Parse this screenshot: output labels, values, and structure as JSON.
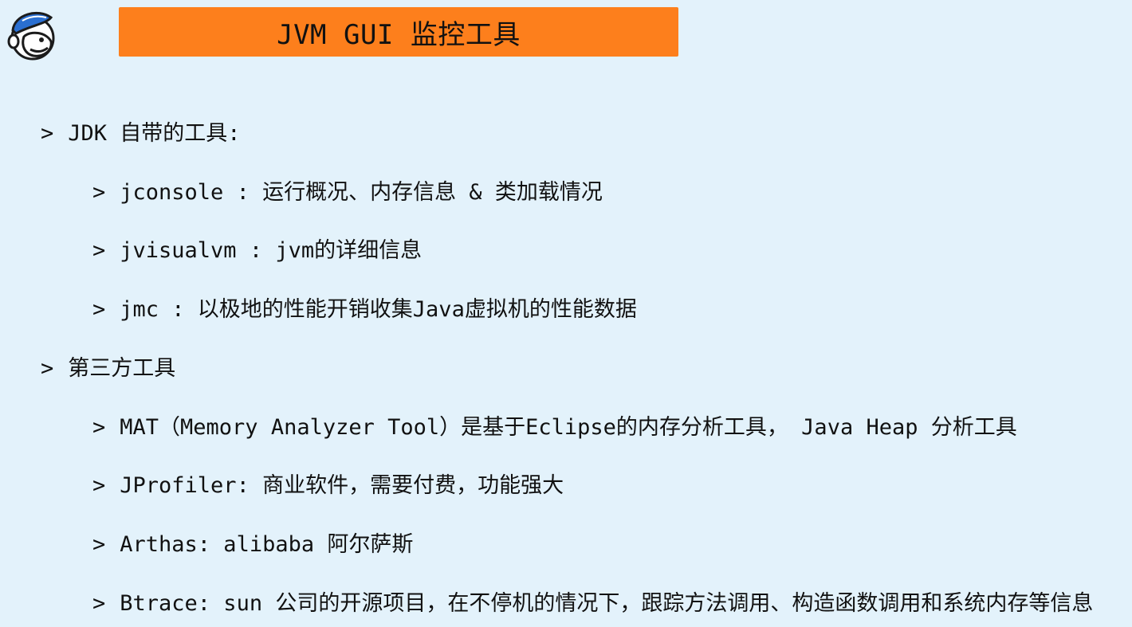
{
  "title": "JVM GUI 监控工具",
  "logo": {
    "icon": "chimp-mascot-icon"
  },
  "accent_color": "#fd7f1c",
  "background_color": "#e3f2fb",
  "items": [
    {
      "marker": ">",
      "text": "JDK 自带的工具:"
    },
    {
      "marker": ">",
      "text": "jconsole :  运行概况、内存信息 & 类加载情况"
    },
    {
      "marker": ">",
      "text": "jvisualvm : jvm的详细信息"
    },
    {
      "marker": ">",
      "text": "jmc : 以极地的性能开销收集Java虚拟机的性能数据"
    },
    {
      "marker": ">",
      "text": "第三方工具"
    },
    {
      "marker": ">",
      "text": "MAT（Memory Analyzer Tool）是基于Eclipse的内存分析工具， Java Heap 分析工具"
    },
    {
      "marker": ">",
      "text": "JProfiler: 商业软件，需要付费，功能强大"
    },
    {
      "marker": ">",
      "text": "Arthas: alibaba 阿尔萨斯"
    },
    {
      "marker": ">",
      "text": "Btrace: sun 公司的开源项目，在不停机的情况下，跟踪方法调用、构造函数调用和系统内存等信息"
    }
  ]
}
